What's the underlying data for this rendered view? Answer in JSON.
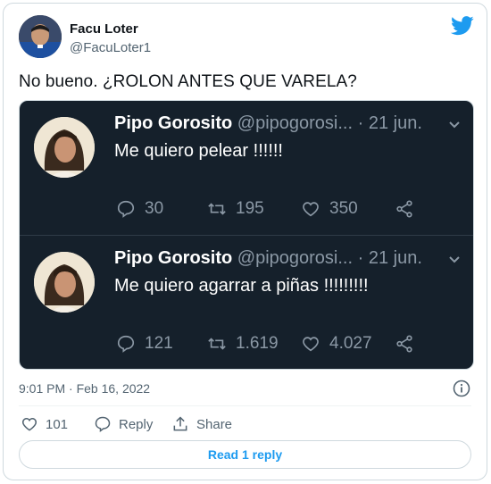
{
  "colors": {
    "accent": "#1d9bf0",
    "muted": "#536471",
    "dark_bg": "#15202b"
  },
  "author": {
    "name": "Facu Loter",
    "handle": "@FacuLoter1"
  },
  "tweet": {
    "text": "No bueno. ¿ROLON ANTES QUE VARELA?"
  },
  "media": {
    "tweets": [
      {
        "name": "Pipo Gorosito",
        "handle": "@pipogorosi...",
        "date": " · 21 jun.",
        "text": "Me quiero pelear !!!!!!",
        "replies": "30",
        "retweets": "195",
        "likes": "350"
      },
      {
        "name": "Pipo Gorosito",
        "handle": "@pipogorosi...",
        "date": " · 21 jun.",
        "text": "Me quiero agarrar a piñas !!!!!!!!!",
        "replies": "121",
        "retweets": "1.619",
        "likes": "4.027"
      }
    ]
  },
  "meta": {
    "timestamp": "9:01 PM · Feb 16, 2022"
  },
  "actions": {
    "likes": "101",
    "reply_label": "Reply",
    "share_label": "Share"
  },
  "read_replies": "Read 1 reply"
}
